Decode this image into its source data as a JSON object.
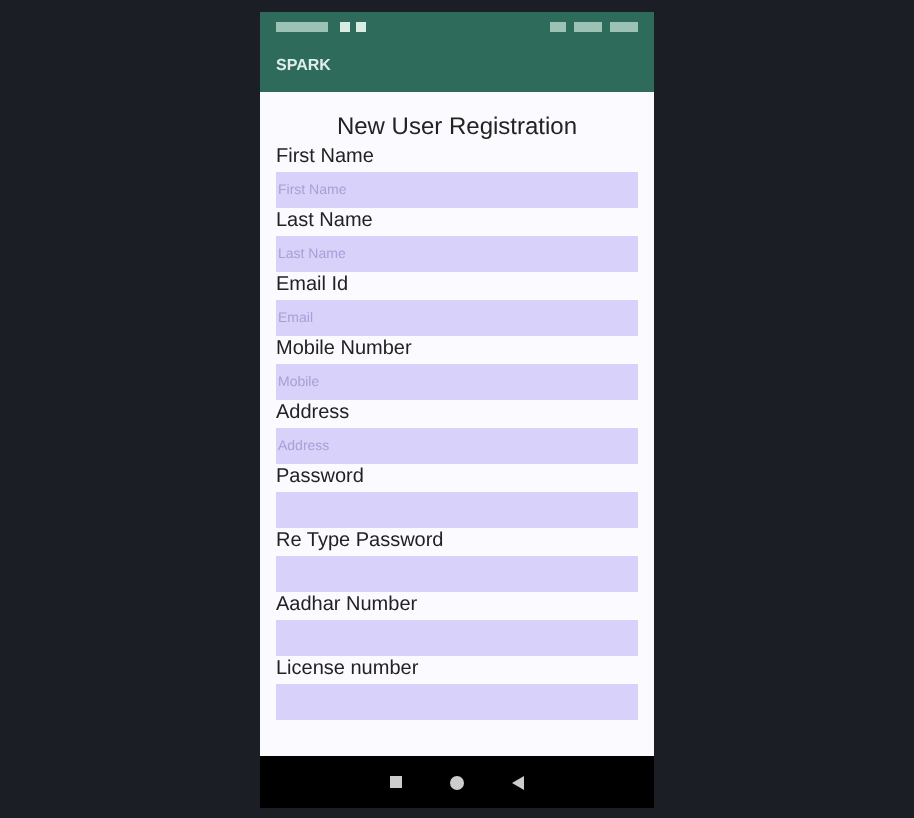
{
  "app_bar": {
    "title": "SPARK"
  },
  "form": {
    "title": "New User Registration",
    "fields": [
      {
        "label": "First Name",
        "placeholder": "First Name"
      },
      {
        "label": "Last Name",
        "placeholder": "Last Name"
      },
      {
        "label": "Email Id",
        "placeholder": "Email"
      },
      {
        "label": "Mobile Number",
        "placeholder": "Mobile"
      },
      {
        "label": "Address",
        "placeholder": "Address"
      },
      {
        "label": "Password"
      },
      {
        "label": "Re Type Password"
      },
      {
        "label": "Aadhar Number"
      },
      {
        "label": "License number"
      }
    ]
  }
}
